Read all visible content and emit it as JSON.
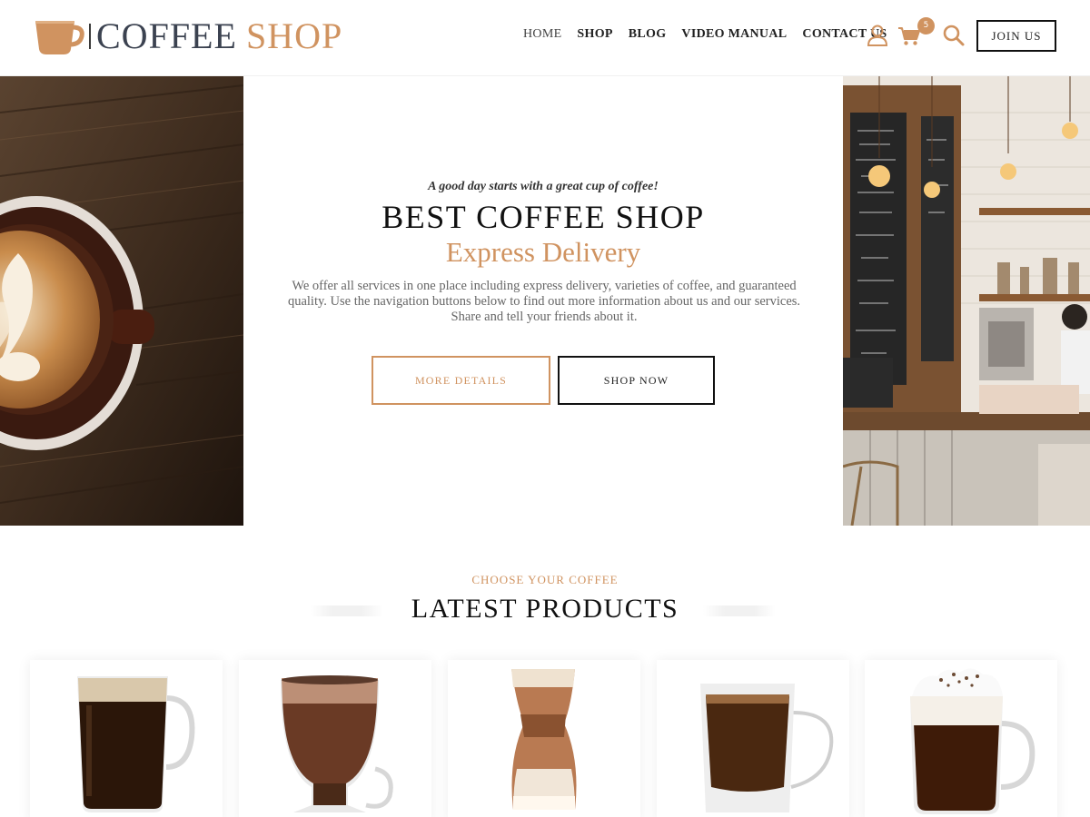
{
  "header": {
    "logo": {
      "word1": "COFFEE",
      "word2": "SHOP"
    },
    "nav": [
      {
        "label": "HOME"
      },
      {
        "label": "SHOP"
      },
      {
        "label": "BLOG"
      },
      {
        "label": "VIDEO MANUAL"
      },
      {
        "label": "CONTACT US"
      }
    ],
    "icons": {
      "account": "user-icon",
      "cart": "cart-icon",
      "search": "search-icon"
    },
    "cart_count": "5",
    "join_label": "JOIN US"
  },
  "hero": {
    "tagline": "A good day starts with a great cup of coffee!",
    "title": "BEST COFFEE SHOP",
    "subtitle": "Express Delivery",
    "description": "We offer all services in one place including express delivery, varieties of coffee, and guaranteed quality. Use the navigation buttons below to find out more information about us and our services. Share and tell your friends about it.",
    "more_label": "MORE DETAILS",
    "shop_label": "SHOP NOW"
  },
  "products": {
    "kicker": "CHOOSE YOUR COFFEE",
    "title": "LATEST PRODUCTS",
    "items": [
      {
        "image": "irish-coffee-mug"
      },
      {
        "image": "mocha-tulip-glass"
      },
      {
        "image": "latte-macchiato-glass"
      },
      {
        "image": "americano-double-wall-cup"
      },
      {
        "image": "cream-topped-coffee-mug"
      }
    ]
  },
  "colors": {
    "accent": "#d09360",
    "dark": "#111111",
    "logo_dark": "#3b4250"
  }
}
